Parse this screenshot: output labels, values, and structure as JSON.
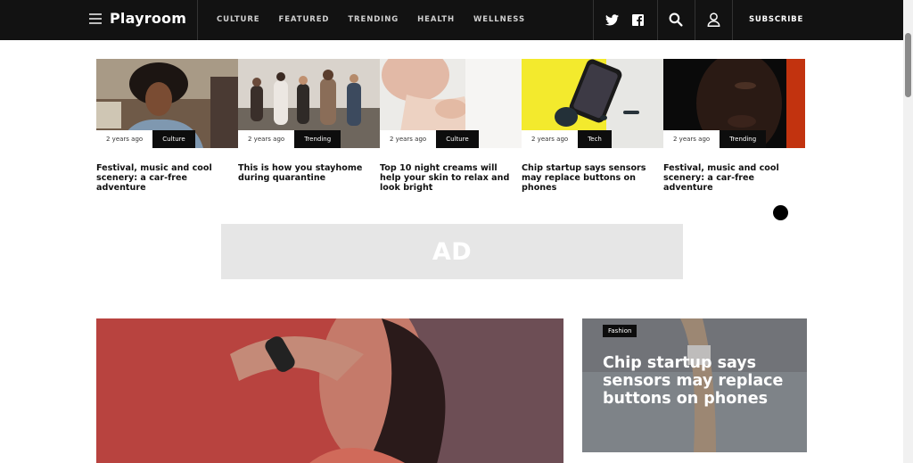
{
  "header": {
    "logo": "Playroom",
    "nav": [
      "CULTURE",
      "FEATURED",
      "TRENDING",
      "HEALTH",
      "WELLNESS"
    ],
    "subscribe": "SUBSCRIBE",
    "icons": [
      "menu-icon",
      "twitter-icon",
      "facebook-icon",
      "search-icon",
      "user-icon"
    ]
  },
  "cards": [
    {
      "time": "2 years ago",
      "category": "Culture",
      "title": "Festival, music and cool scenery: a car-free adventure"
    },
    {
      "time": "2 years ago",
      "category": "Trending",
      "title": "This is how you stayhome during quarantine"
    },
    {
      "time": "2 years ago",
      "category": "Culture",
      "title": "Top 10 night creams will help your skin to relax and look bright"
    },
    {
      "time": "2 years ago",
      "category": "Tech",
      "title": "Chip startup says sensors may replace buttons on phones"
    },
    {
      "time": "2 years ago",
      "category": "Trending",
      "title": "Festival, music and cool scenery: a car-free adventure"
    }
  ],
  "ad": {
    "label": "AD"
  },
  "side_story": {
    "category": "Fashion",
    "title": "Chip startup says sensors may replace buttons on phones"
  }
}
